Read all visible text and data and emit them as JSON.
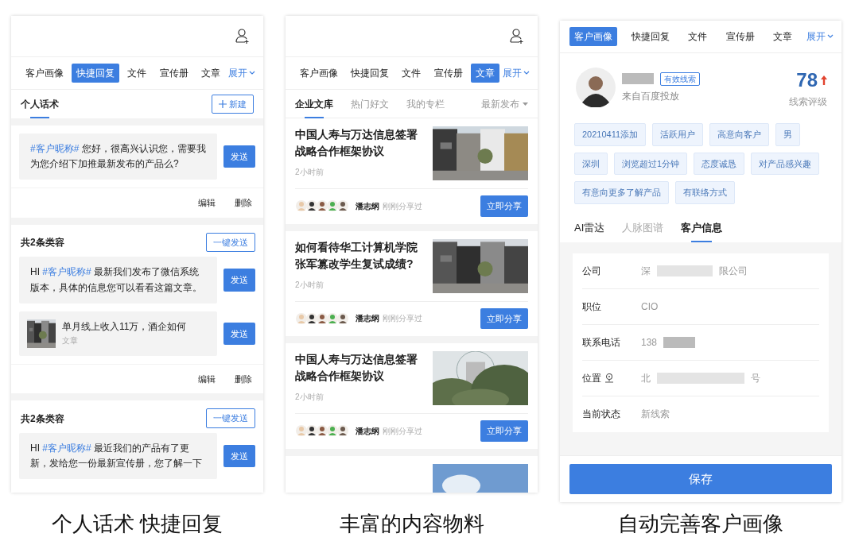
{
  "panels": [
    {
      "kind": "replies",
      "caption": "个人话术 快捷回复",
      "tabs": [
        {
          "label": "客户画像",
          "selected": false
        },
        {
          "label": "快捷回复",
          "selected": true
        },
        {
          "label": "文件",
          "selected": false
        },
        {
          "label": "宣传册",
          "selected": false
        },
        {
          "label": "文章",
          "selected": false
        }
      ],
      "expand": "展开",
      "subtabs": [
        {
          "label": "个人话术",
          "selected": true
        }
      ],
      "new_button": "新建",
      "groups": [
        {
          "messages": [
            {
              "kind": "text",
              "tag": "#客户昵称#",
              "text": "您好，很高兴认识您，需要我为您介绍下加推最新发布的产品么?",
              "send": "发送"
            }
          ],
          "actions": [
            "编辑",
            "删除"
          ]
        },
        {
          "title": "共2条类容",
          "bulk_button": "一键发送",
          "messages": [
            {
              "kind": "text",
              "prefix": "HI",
              "tag": "#客户昵称#",
              "text": "最新我们发布了微信系统版本，具体的信息您可以看看这篇文章。",
              "send": "发送"
            },
            {
              "kind": "article",
              "title": "单月线上收入11万，酒企如何",
              "subtitle": "文章",
              "send": "发送"
            }
          ],
          "actions": [
            "编辑",
            "删除"
          ]
        },
        {
          "title": "共2条类容",
          "bulk_button": "一键发送",
          "messages": [
            {
              "kind": "text",
              "prefix": "HI",
              "tag": "#客户昵称#",
              "text": "最近我们的产品有了更新，发给您一份最新宣传册，您了解一下",
              "send": "发送"
            }
          ]
        }
      ]
    },
    {
      "kind": "articles",
      "caption": "丰富的内容物料",
      "tabs": [
        {
          "label": "客户画像",
          "selected": false
        },
        {
          "label": "快捷回复",
          "selected": false
        },
        {
          "label": "文件",
          "selected": false
        },
        {
          "label": "宣传册",
          "selected": false
        },
        {
          "label": "文章",
          "selected": true
        }
      ],
      "expand": "展开",
      "subtabs": [
        {
          "label": "企业文库",
          "selected": true
        },
        {
          "label": "热门好文",
          "selected": false
        },
        {
          "label": "我的专栏",
          "selected": false
        }
      ],
      "sort": "最新发布",
      "articles": [
        {
          "kind": "article",
          "title": "中国人寿与万达信息签署战略合作框架协议",
          "time": "2小时前",
          "sharer": "潘志纲",
          "note": "刚刚分享过",
          "button": "立即分享"
        },
        {
          "kind": "article",
          "title": "如何看待华工计算机学院张军篡改学生复试成绩?",
          "time": "2小时前",
          "sharer": "潘志纲",
          "note": "刚刚分享过",
          "button": "立即分享"
        },
        {
          "kind": "article",
          "title": "中国人寿与万达信息签署战略合作框架协议",
          "time": "2小时前",
          "sharer": "潘志纲",
          "note": "刚刚分享过",
          "button": "立即分享"
        },
        {
          "kind": "picture"
        }
      ]
    },
    {
      "kind": "profile",
      "caption": "自动完善客户画像",
      "tabs": [
        {
          "label": "客户画像",
          "selected": true
        },
        {
          "label": "快捷回复",
          "selected": false
        },
        {
          "label": "文件",
          "selected": false
        },
        {
          "label": "宣传册",
          "selected": false
        },
        {
          "label": "文章",
          "selected": false
        }
      ],
      "expand": "展开",
      "badge": "有效线索",
      "source": "来自百度投放",
      "score": "78",
      "score_label": "线索评级",
      "tags": [
        "20210411添加",
        "活跃用户",
        "高意向客户",
        "男",
        "深圳",
        "浏览超过1分钟",
        "态度诚恳",
        "对产品感兴趣",
        "有意向更多了解产品",
        "有联络方式"
      ],
      "subtabs": [
        {
          "label": "AI雷达",
          "selected": false,
          "muted": false
        },
        {
          "label": "人脉图谱",
          "selected": false,
          "muted": true
        },
        {
          "label": "客户信息",
          "selected": true,
          "muted": false
        }
      ],
      "fields": [
        {
          "label": "公司",
          "value": "深",
          "value_end": "限公司"
        },
        {
          "label": "职位",
          "value": "CIO"
        },
        {
          "label": "联系电话",
          "value": "138"
        },
        {
          "label": "位置",
          "kind": "location",
          "value": "北",
          "value_end": "号"
        },
        {
          "label": "当前状态",
          "value": "新线索"
        }
      ],
      "save": "保存"
    }
  ]
}
